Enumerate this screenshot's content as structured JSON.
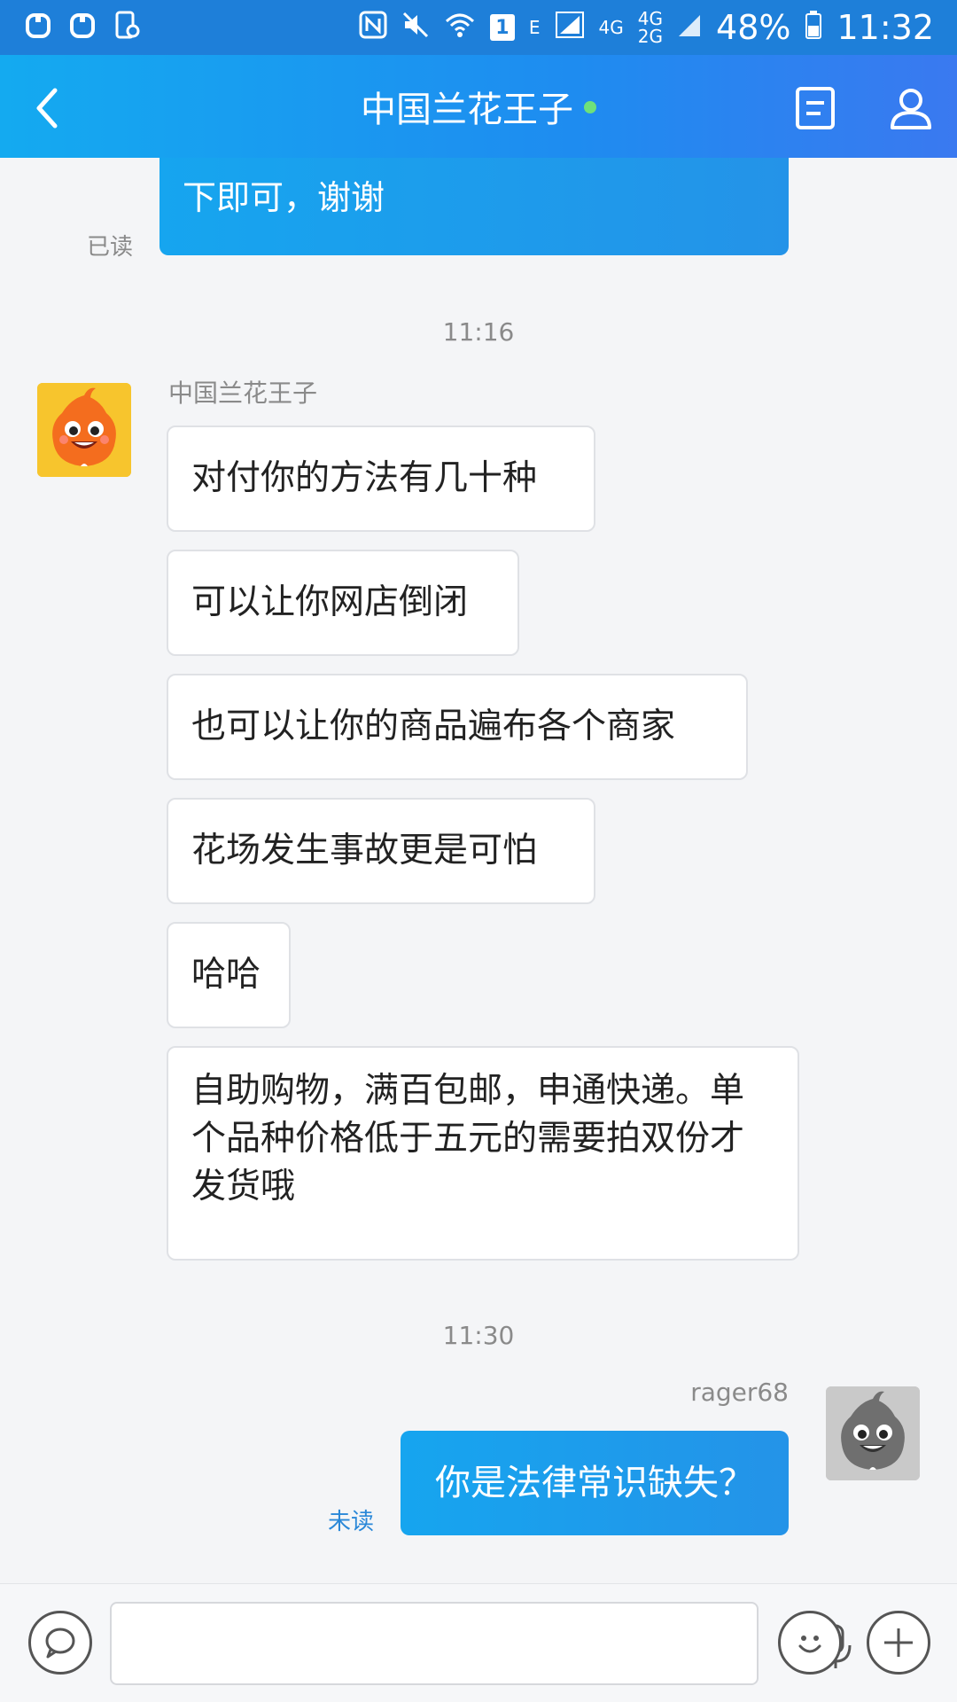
{
  "status_bar": {
    "battery": "48%",
    "time": "11:32",
    "network_small": "E",
    "network_4g": "4G",
    "network_4g_2": "4G",
    "network_2g": "2G",
    "sim_badge": "1"
  },
  "header": {
    "title": "中国兰花王子"
  },
  "chat": {
    "partial_message_line": "下即可，谢谢",
    "partial_read_status": "已读",
    "timestamp_1": "11:16",
    "incoming_sender": "中国兰花王子",
    "incoming_messages": [
      "对付你的方法有几十种",
      "可以让你网店倒闭",
      "也可以让你的商品遍布各个商家",
      "花场发生事故更是可怕",
      "哈哈",
      "自助购物，满百包邮，申通快递。单个品种价格低于五元的需要拍双份才发货哦"
    ],
    "timestamp_2": "11:30",
    "outgoing_sender": "rager68",
    "outgoing_message": "你是法律常识缺失？",
    "outgoing_read_status": "未读"
  },
  "input_bar": {
    "text_value": ""
  },
  "colors": {
    "header_start": "#14aaf0",
    "header_end": "#3a79f0",
    "outgoing_bubble": "#16a5ef",
    "online_dot": "#6ee17a",
    "unread_text": "#2a88d8"
  },
  "icons": {
    "back": "chevron-left-icon",
    "document": "document-icon",
    "profile": "person-icon",
    "voice_toggle": "speech-bubble-icon",
    "mic": "microphone-icon",
    "emoji": "smiley-icon",
    "more": "plus-icon"
  }
}
